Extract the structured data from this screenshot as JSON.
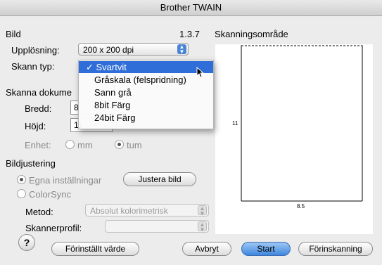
{
  "window": {
    "title": "Brother TWAIN"
  },
  "bild": {
    "section_label": "Bild",
    "version": "1.3.7",
    "resolution_label": "Upplösning:",
    "resolution_value": "200 x 200 dpi",
    "scan_type_label": "Skann typ:"
  },
  "scan_type_menu": {
    "items": [
      {
        "label": "✓ Svartvit",
        "selected": true
      },
      {
        "label": "Gråskala (felspridning)"
      },
      {
        "label": "Sann grå"
      },
      {
        "label": "8bit Färg"
      },
      {
        "label": "24bit Färg"
      }
    ]
  },
  "document": {
    "section_label": "Skanna dokume",
    "width_label": "Bredd:",
    "width_value": "8",
    "height_label": "Höjd:",
    "height_value": "11",
    "unit_label": "Enhet:",
    "unit_mm": "mm",
    "unit_inch": "tum",
    "selected_unit": "tum"
  },
  "adjust": {
    "section_label": "Bildjustering",
    "own_settings": "Egna inställningar",
    "adjust_button": "Justera bild",
    "colorsync": "ColorSync",
    "method_label": "Metod:",
    "method_value": "Absolut kolorimetrisk",
    "profile_label": "Skannerprofil:",
    "profile_value": ""
  },
  "scan_area": {
    "label": "Skanningsområde",
    "height_value": "11",
    "width_value": "8.5"
  },
  "buttons": {
    "help": "?",
    "defaults": "Förinställt värde",
    "cancel": "Avbryt",
    "start": "Start",
    "prescan": "Förinskanning"
  }
}
